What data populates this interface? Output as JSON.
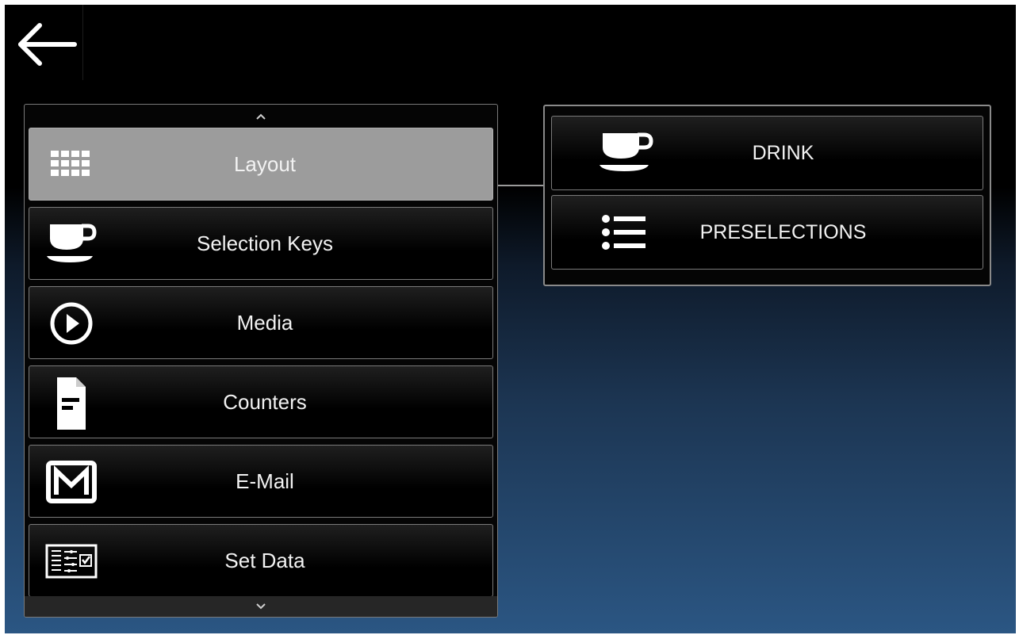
{
  "header": {
    "back_icon": "arrow-left-icon"
  },
  "menu": {
    "scroll_up_icon": "chevron-up-icon",
    "scroll_down_icon": "chevron-down-icon",
    "items": [
      {
        "label": "Layout",
        "icon": "grid-icon",
        "selected": true
      },
      {
        "label": "Selection Keys",
        "icon": "cup-icon",
        "selected": false
      },
      {
        "label": "Media",
        "icon": "play-circle-icon",
        "selected": false
      },
      {
        "label": "Counters",
        "icon": "document-icon",
        "selected": false
      },
      {
        "label": "E-Mail",
        "icon": "mail-icon",
        "selected": false
      },
      {
        "label": "Set Data",
        "icon": "settings-form-icon",
        "selected": false
      }
    ]
  },
  "submenu": {
    "items": [
      {
        "label": "DRINK",
        "icon": "cup-icon"
      },
      {
        "label": "PRESELECTIONS",
        "icon": "list-icon"
      }
    ]
  },
  "colors": {
    "selected_item": "#9c9c9c",
    "item_border": "#7a7a7a",
    "text": "#f2f2f2",
    "background_bottom": "#2b5683"
  }
}
